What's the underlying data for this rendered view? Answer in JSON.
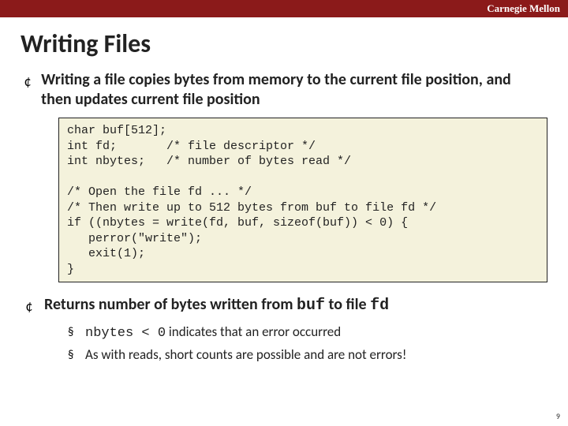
{
  "header": {
    "institution": "Carnegie Mellon"
  },
  "title": "Writing Files",
  "bullets": [
    {
      "text": "Writing a file copies bytes from memory to the current file position, and then updates current file position"
    },
    {
      "prefix": "Returns number of bytes written from ",
      "code1": "buf",
      "mid": " to file ",
      "code2": "fd"
    }
  ],
  "code": "char buf[512];\nint fd;       /* file descriptor */\nint nbytes;   /* number of bytes read */\n\n/* Open the file fd ... */\n/* Then write up to 512 bytes from buf to file fd */\nif ((nbytes = write(fd, buf, sizeof(buf)) < 0) {\n   perror(\"write\");\n   exit(1);\n}",
  "subbullets": [
    {
      "code": "nbytes < 0",
      "rest": " indicates that an error occurred"
    },
    {
      "text": "As with reads, short counts are possible and are not errors!"
    }
  ],
  "page_number": "9"
}
